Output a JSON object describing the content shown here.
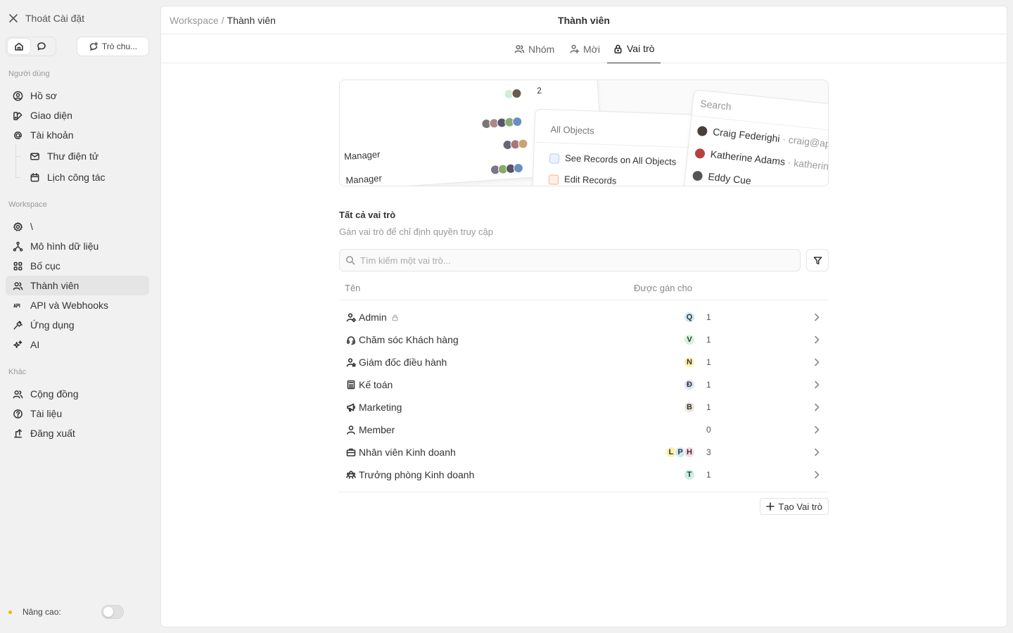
{
  "sidebar": {
    "exit_label": "Thoát Cài đặt",
    "chat_button": "Trò chu...",
    "section_user": "Người dùng",
    "section_workspace": "Workspace",
    "section_other": "Khác",
    "user_items": [
      "Hồ sơ",
      "Giao diện",
      "Tài khoản"
    ],
    "account_sub_items": [
      "Thư điện tử",
      "Lịch công tác"
    ],
    "workspace_items": [
      "\\",
      "Mô hình dữ liệu",
      "Bố cục",
      "Thành viên",
      "API và Webhooks",
      "Ứng dụng",
      "AI"
    ],
    "other_items": [
      "Cộng đồng",
      "Tài liệu",
      "Đăng xuất"
    ],
    "advanced_label": "Nâng cao:",
    "advanced_enabled": false
  },
  "header": {
    "breadcrumb_root": "Workspace",
    "breadcrumb_sep": "/",
    "breadcrumb_current": "Thành viên",
    "title": "Thành viên"
  },
  "tabs": [
    "Nhóm",
    "Mời",
    "Vai trò"
  ],
  "active_tab": "Vai trò",
  "hero": {
    "count": "2",
    "manager1": "Manager",
    "manager2": "Manager",
    "all_objects": "All Objects",
    "see_records": "See Records on All Objects",
    "edit_records": "Edit Records",
    "search": "Search",
    "person1": "Craig Federighi",
    "email1": "· craig@apple",
    "person2": "Katherine Adams",
    "email2": "· katherine",
    "person3": "Eddy Cue"
  },
  "roles_section": {
    "title": "Tất cả vai trò",
    "subtitle": "Gán vai trò để chỉ định quyền truy cập",
    "search_placeholder": "Tìm kiếm một vai trò...",
    "col_name": "Tên",
    "col_assigned": "Được gán cho",
    "create_button": "Tạo Vai trò"
  },
  "roles": [
    {
      "name": "Admin",
      "icon": "user-cog-icon",
      "avatars": [
        {
          "letter": "Q",
          "color": "#c9ecf6"
        }
      ],
      "count": "1",
      "locked": true
    },
    {
      "name": "Chăm sóc Khách hàng",
      "icon": "headset-icon",
      "avatars": [
        {
          "letter": "V",
          "color": "#d3f2dc"
        }
      ],
      "count": "1"
    },
    {
      "name": "Giám đốc điều hành",
      "icon": "user-star-icon",
      "avatars": [
        {
          "letter": "N",
          "color": "#fdf0a8"
        }
      ],
      "count": "1"
    },
    {
      "name": "Kế toán",
      "icon": "calculator-icon",
      "avatars": [
        {
          "letter": "Đ",
          "color": "#dde3f8"
        }
      ],
      "count": "1"
    },
    {
      "name": "Marketing",
      "icon": "megaphone-icon",
      "avatars": [
        {
          "letter": "B",
          "color": "#ebe6da"
        }
      ],
      "count": "1"
    },
    {
      "name": "Member",
      "icon": "user-icon",
      "avatars": [],
      "count": "0"
    },
    {
      "name": "Nhân viên Kinh doanh",
      "icon": "briefcase-icon",
      "avatars": [
        {
          "letter": "L",
          "color": "#fdf0a8"
        },
        {
          "letter": "P",
          "color": "#c9ecf6"
        },
        {
          "letter": "H",
          "color": "#fbd9e4"
        }
      ],
      "count": "3"
    },
    {
      "name": "Trưởng phòng Kinh doanh",
      "icon": "users-group-icon",
      "avatars": [
        {
          "letter": "T",
          "color": "#cbefe6"
        }
      ],
      "count": "1"
    }
  ]
}
